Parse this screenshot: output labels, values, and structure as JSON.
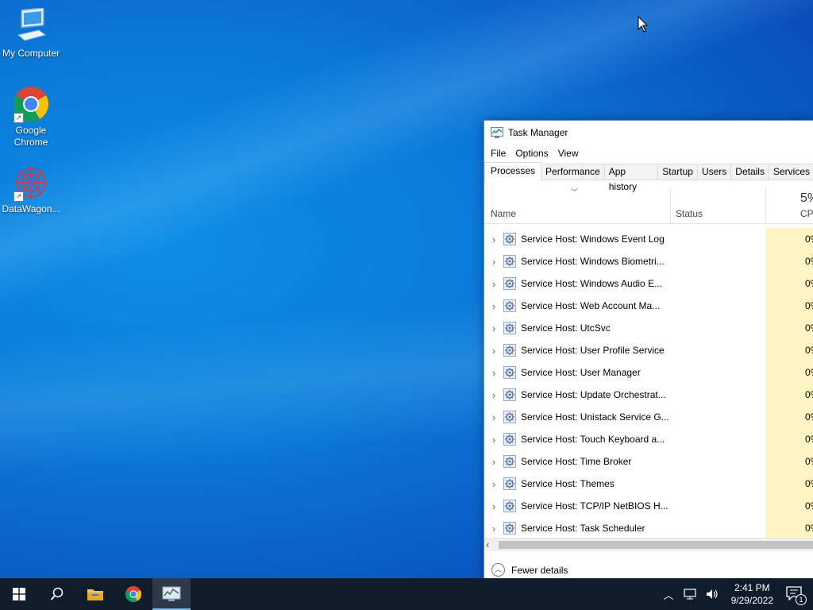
{
  "desktop": {
    "icons": [
      {
        "label": "My Computer",
        "icon": "computer-icon"
      },
      {
        "label": "Google Chrome",
        "icon": "chrome-icon"
      },
      {
        "label": "DataWagon...",
        "icon": "datawagon-icon"
      }
    ]
  },
  "task_manager": {
    "title": "Task Manager",
    "menu": [
      "File",
      "Options",
      "View"
    ],
    "tabs": [
      "Processes",
      "Performance",
      "App history",
      "Startup",
      "Users",
      "Details",
      "Services"
    ],
    "active_tab": "Processes",
    "columns": {
      "name": "Name",
      "status": "Status",
      "cpu_percent": "5%",
      "cpu": "CPU"
    },
    "processes": [
      {
        "name": "Service Host: Windows Event Log",
        "cpu": "0%"
      },
      {
        "name": "Service Host: Windows Biometri...",
        "cpu": "0%"
      },
      {
        "name": "Service Host: Windows Audio E...",
        "cpu": "0%"
      },
      {
        "name": "Service Host: Web Account Ma...",
        "cpu": "0%"
      },
      {
        "name": "Service Host: UtcSvc",
        "cpu": "0%"
      },
      {
        "name": "Service Host: User Profile Service",
        "cpu": "0%"
      },
      {
        "name": "Service Host: User Manager",
        "cpu": "0%"
      },
      {
        "name": "Service Host: Update Orchestrat...",
        "cpu": "0%"
      },
      {
        "name": "Service Host: Unistack Service G...",
        "cpu": "0%"
      },
      {
        "name": "Service Host: Touch Keyboard a...",
        "cpu": "0%"
      },
      {
        "name": "Service Host: Time Broker",
        "cpu": "0%"
      },
      {
        "name": "Service Host: Themes",
        "cpu": "0%"
      },
      {
        "name": "Service Host: TCP/IP NetBIOS H...",
        "cpu": "0%"
      },
      {
        "name": "Service Host: Task Scheduler",
        "cpu": "0%"
      }
    ],
    "fewer_details": "Fewer details"
  },
  "taskbar": {
    "clock_time": "2:41 PM",
    "clock_date": "9/29/2022",
    "notification_count": "1"
  },
  "colors": {
    "taskbar": "#0f1c2b",
    "cpu_highlight": "#fff4c4",
    "accent": "#76b9ed"
  }
}
